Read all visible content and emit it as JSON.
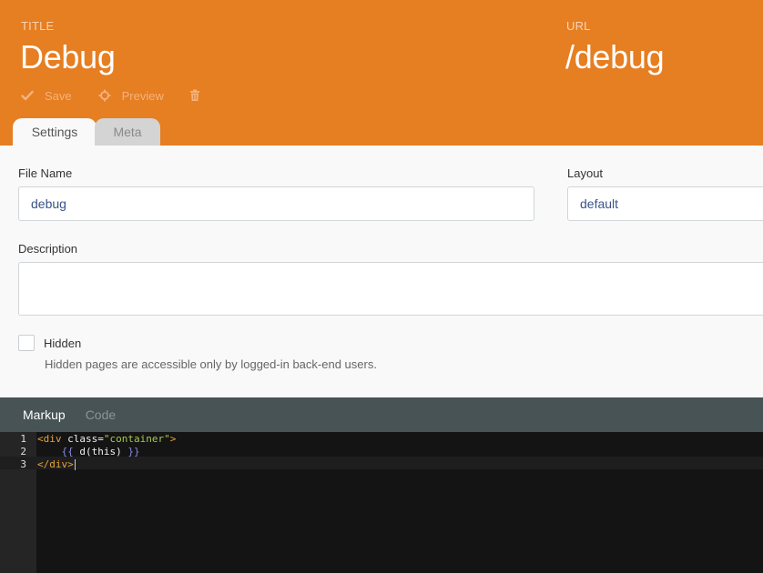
{
  "header": {
    "title_label": "TITLE",
    "title_value": "Debug",
    "url_label": "URL",
    "url_value": "/debug",
    "toolbar": {
      "save_label": "Save",
      "preview_label": "Preview",
      "save_icon": "check-icon",
      "preview_icon": "crosshair-icon",
      "delete_icon": "trash-icon"
    }
  },
  "tabs": [
    {
      "label": "Settings",
      "active": true
    },
    {
      "label": "Meta",
      "active": false
    }
  ],
  "form": {
    "file_name_label": "File Name",
    "file_name_value": "debug",
    "layout_label": "Layout",
    "layout_value": "default",
    "description_label": "Description",
    "description_value": "",
    "hidden_label": "Hidden",
    "hidden_checked": false,
    "hidden_help": "Hidden pages are accessible only by logged-in back-end users."
  },
  "editor": {
    "tabs": [
      {
        "label": "Markup",
        "active": true
      },
      {
        "label": "Code",
        "active": false
      }
    ],
    "line_numbers": [
      "1",
      "2",
      "3"
    ],
    "code": {
      "l1_tag_open": "<div",
      "l1_attr": " class=",
      "l1_str": "\"container\"",
      "l1_tag_close": ">",
      "l2_indent": "    ",
      "l2_open": "{{",
      "l2_expr": " d(this) ",
      "l2_close": "}}",
      "l3_tag": "</div>"
    }
  },
  "colors": {
    "header_bg": "#e67e22",
    "editor_tabs_bg": "#475355",
    "editor_bg": "#141414"
  }
}
